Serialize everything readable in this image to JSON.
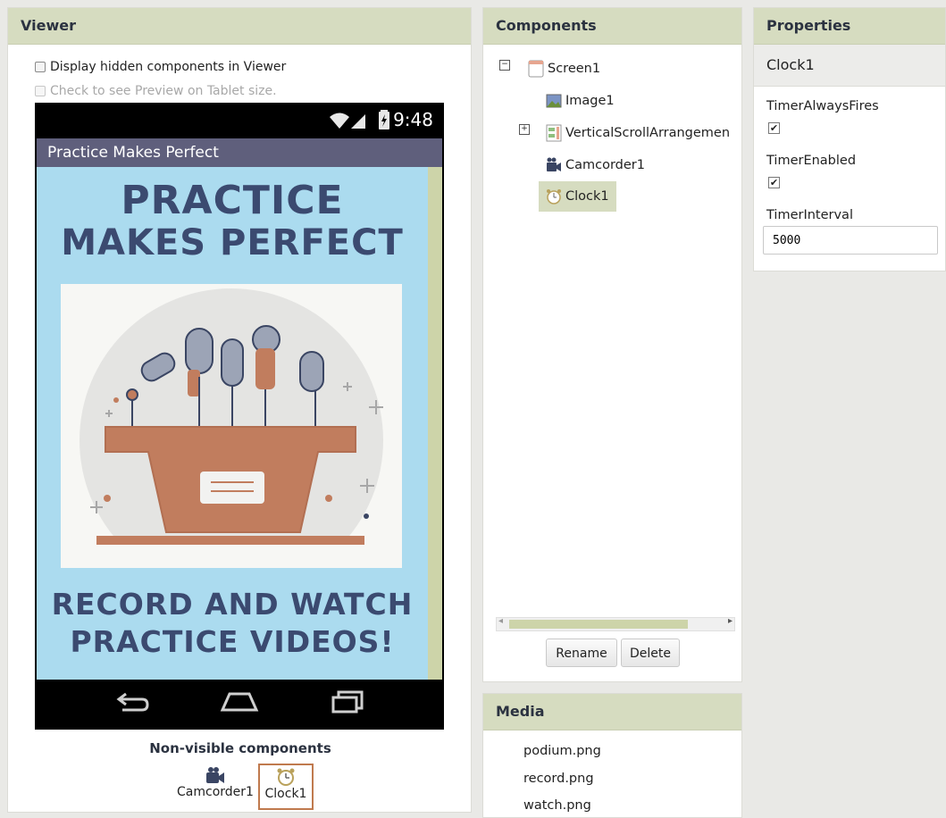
{
  "viewer": {
    "title": "Viewer",
    "display_hidden_label": "Display hidden components in Viewer",
    "tablet_preview_label": "Check to see Preview on Tablet size.",
    "phone": {
      "status_time": "9:48",
      "app_title": "Practice Makes Perfect",
      "headline_line1": "PRACTICE",
      "headline_line2": "MAKES PERFECT",
      "footer_line1": "RECORD AND WATCH",
      "footer_line2": "PRACTICE VIDEOS!"
    },
    "nonvisible_title": "Non-visible components",
    "nonvisible_items": [
      "Camcorder1",
      "Clock1"
    ]
  },
  "components": {
    "title": "Components",
    "tree": [
      "Screen1",
      "Image1",
      "VerticalScrollArrangemen",
      "Camcorder1",
      "Clock1"
    ],
    "rename_label": "Rename",
    "delete_label": "Delete"
  },
  "media": {
    "title": "Media",
    "files": [
      "podium.png",
      "record.png",
      "watch.png"
    ]
  },
  "properties": {
    "title": "Properties",
    "component": "Clock1",
    "timer_always_fires_label": "TimerAlwaysFires",
    "timer_always_fires": true,
    "timer_enabled_label": "TimerEnabled",
    "timer_enabled": true,
    "timer_interval_label": "TimerInterval",
    "timer_interval_value": "5000"
  },
  "colors": {
    "panel_header": "#d6dcc0",
    "phone_background": "#abdbef",
    "headline_text": "#3b4a70",
    "podium": "#c17d5e",
    "selection_border": "#c07a4e"
  }
}
